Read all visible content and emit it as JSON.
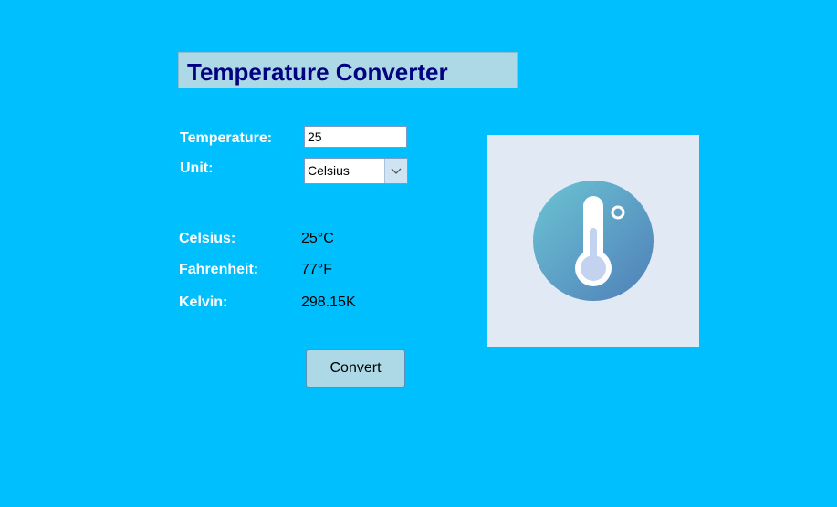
{
  "app": {
    "title": "Temperature Converter"
  },
  "form": {
    "temperature_label": "Temperature:",
    "temperature_value": "25",
    "unit_label": "Unit:",
    "unit_selected": "Celsius"
  },
  "results": {
    "celsius_label": "Celsius:",
    "celsius_value": "25°C",
    "fahrenheit_label": "Fahrenheit:",
    "fahrenheit_value": "77°F",
    "kelvin_label": "Kelvin:",
    "kelvin_value": "298.15K"
  },
  "actions": {
    "convert_label": "Convert"
  },
  "illustration": {
    "icon": "thermometer-icon"
  },
  "colors": {
    "background": "#00bfff",
    "title_bg": "#add8e6",
    "title_text": "#000080",
    "button_bg": "#add8e6",
    "image_bg": "#e1e9f5"
  }
}
